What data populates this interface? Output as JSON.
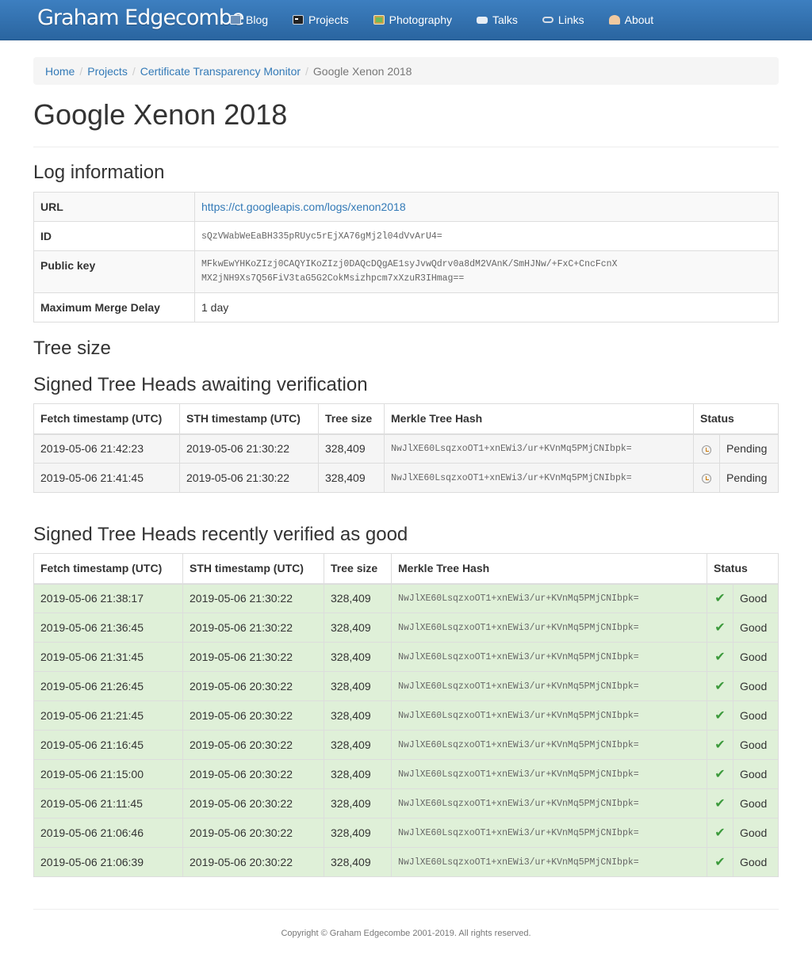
{
  "navbar": {
    "brand": "Graham Edgecombe",
    "items": [
      {
        "label": "Blog",
        "icon": "book-icon"
      },
      {
        "label": "Projects",
        "icon": "terminal-icon"
      },
      {
        "label": "Photography",
        "icon": "picture-icon"
      },
      {
        "label": "Talks",
        "icon": "speech-bubble-icon"
      },
      {
        "label": "Links",
        "icon": "chain-link-icon"
      },
      {
        "label": "About",
        "icon": "person-icon"
      }
    ]
  },
  "breadcrumb": {
    "items": [
      "Home",
      "Projects",
      "Certificate Transparency Monitor"
    ],
    "active": "Google Xenon 2018"
  },
  "page_title": "Google Xenon 2018",
  "log_info": {
    "heading": "Log information",
    "rows": [
      {
        "key": "URL",
        "value": "https://ct.googleapis.com/logs/xenon2018"
      },
      {
        "key": "ID",
        "value": "sQzVWabWeEaBH335pRUyc5rEjXA76gMj2l04dVvArU4="
      },
      {
        "key": "Public key",
        "value_line1": "MFkwEwYHKoZIzj0CAQYIKoZIzj0DAQcDQgAE1syJvwQdrv0a8dM2VAnK/SmHJNw/+FxC+CncFcnX",
        "value_line2": "MX2jNH9Xs7Q56FiV3taG5G2CokMsizhpcm7xXzuR3IHmag=="
      },
      {
        "key": "Maximum Merge Delay",
        "value": "1 day"
      }
    ]
  },
  "tree_size_heading": "Tree size",
  "pending": {
    "heading": "Signed Tree Heads awaiting verification",
    "columns": [
      "Fetch timestamp (UTC)",
      "STH timestamp (UTC)",
      "Tree size",
      "Merkle Tree Hash",
      "Status"
    ],
    "rows": [
      {
        "fetch": "2019-05-06 21:42:23",
        "sth": "2019-05-06 21:30:22",
        "size": "328,409",
        "hash": "NwJlXE60LsqzxoOT1+xnEWi3/ur+KVnMq5PMjCNIbpk=",
        "status": "Pending"
      },
      {
        "fetch": "2019-05-06 21:41:45",
        "sth": "2019-05-06 21:30:22",
        "size": "328,409",
        "hash": "NwJlXE60LsqzxoOT1+xnEWi3/ur+KVnMq5PMjCNIbpk=",
        "status": "Pending"
      }
    ]
  },
  "verified": {
    "heading": "Signed Tree Heads recently verified as good",
    "columns": [
      "Fetch timestamp (UTC)",
      "STH timestamp (UTC)",
      "Tree size",
      "Merkle Tree Hash",
      "Status"
    ],
    "rows": [
      {
        "fetch": "2019-05-06 21:38:17",
        "sth": "2019-05-06 21:30:22",
        "size": "328,409",
        "hash": "NwJlXE60LsqzxoOT1+xnEWi3/ur+KVnMq5PMjCNIbpk=",
        "status": "Good"
      },
      {
        "fetch": "2019-05-06 21:36:45",
        "sth": "2019-05-06 21:30:22",
        "size": "328,409",
        "hash": "NwJlXE60LsqzxoOT1+xnEWi3/ur+KVnMq5PMjCNIbpk=",
        "status": "Good"
      },
      {
        "fetch": "2019-05-06 21:31:45",
        "sth": "2019-05-06 21:30:22",
        "size": "328,409",
        "hash": "NwJlXE60LsqzxoOT1+xnEWi3/ur+KVnMq5PMjCNIbpk=",
        "status": "Good"
      },
      {
        "fetch": "2019-05-06 21:26:45",
        "sth": "2019-05-06 20:30:22",
        "size": "328,409",
        "hash": "NwJlXE60LsqzxoOT1+xnEWi3/ur+KVnMq5PMjCNIbpk=",
        "status": "Good"
      },
      {
        "fetch": "2019-05-06 21:21:45",
        "sth": "2019-05-06 20:30:22",
        "size": "328,409",
        "hash": "NwJlXE60LsqzxoOT1+xnEWi3/ur+KVnMq5PMjCNIbpk=",
        "status": "Good"
      },
      {
        "fetch": "2019-05-06 21:16:45",
        "sth": "2019-05-06 20:30:22",
        "size": "328,409",
        "hash": "NwJlXE60LsqzxoOT1+xnEWi3/ur+KVnMq5PMjCNIbpk=",
        "status": "Good"
      },
      {
        "fetch": "2019-05-06 21:15:00",
        "sth": "2019-05-06 20:30:22",
        "size": "328,409",
        "hash": "NwJlXE60LsqzxoOT1+xnEWi3/ur+KVnMq5PMjCNIbpk=",
        "status": "Good"
      },
      {
        "fetch": "2019-05-06 21:11:45",
        "sth": "2019-05-06 20:30:22",
        "size": "328,409",
        "hash": "NwJlXE60LsqzxoOT1+xnEWi3/ur+KVnMq5PMjCNIbpk=",
        "status": "Good"
      },
      {
        "fetch": "2019-05-06 21:06:46",
        "sth": "2019-05-06 20:30:22",
        "size": "328,409",
        "hash": "NwJlXE60LsqzxoOT1+xnEWi3/ur+KVnMq5PMjCNIbpk=",
        "status": "Good"
      },
      {
        "fetch": "2019-05-06 21:06:39",
        "sth": "2019-05-06 20:30:22",
        "size": "328,409",
        "hash": "NwJlXE60LsqzxoOT1+xnEWi3/ur+KVnMq5PMjCNIbpk=",
        "status": "Good"
      }
    ]
  },
  "footer": "Copyright © Graham Edgecombe 2001-2019. All rights reserved.",
  "colors": {
    "navbar": "#2f6da8",
    "link": "#337ab7",
    "good_row": "#dff0d8",
    "pending_row": "#f5f5f5"
  }
}
